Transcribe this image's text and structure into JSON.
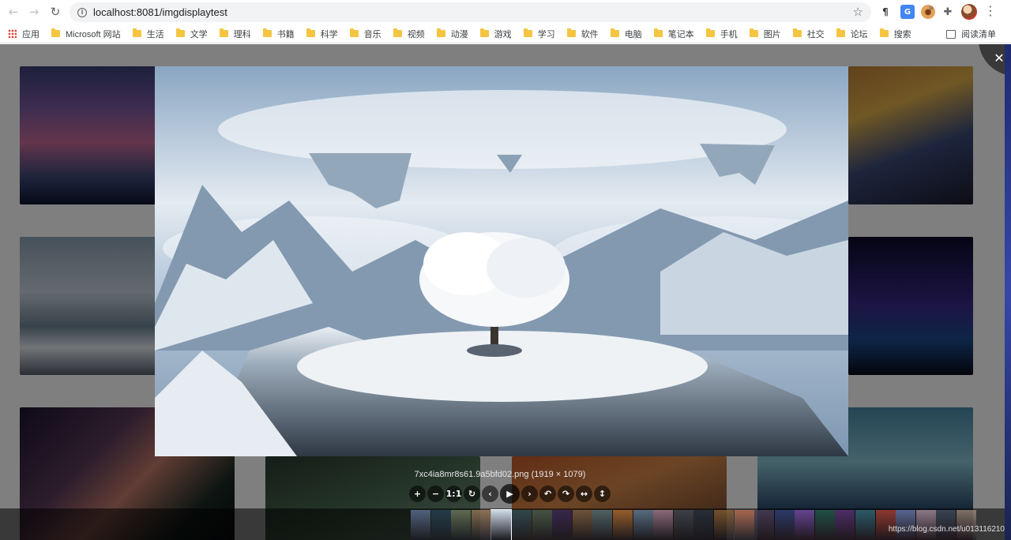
{
  "browser": {
    "url": "localhost:8081/imgdisplaytest",
    "bookmarks": [
      {
        "label": "应用",
        "type": "apps"
      },
      {
        "label": "Microsoft 网站",
        "type": "folder"
      },
      {
        "label": "生活",
        "type": "folder"
      },
      {
        "label": "文学",
        "type": "folder"
      },
      {
        "label": "理科",
        "type": "folder"
      },
      {
        "label": "书籍",
        "type": "folder"
      },
      {
        "label": "科学",
        "type": "folder"
      },
      {
        "label": "音乐",
        "type": "folder"
      },
      {
        "label": "视频",
        "type": "folder"
      },
      {
        "label": "动漫",
        "type": "folder"
      },
      {
        "label": "游戏",
        "type": "folder"
      },
      {
        "label": "学习",
        "type": "folder"
      },
      {
        "label": "软件",
        "type": "folder"
      },
      {
        "label": "电脑",
        "type": "folder"
      },
      {
        "label": "笔记本",
        "type": "folder"
      },
      {
        "label": "手机",
        "type": "folder"
      },
      {
        "label": "图片",
        "type": "folder"
      },
      {
        "label": "社交",
        "type": "folder"
      },
      {
        "label": "论坛",
        "type": "folder"
      },
      {
        "label": "搜索",
        "type": "folder"
      }
    ],
    "more_label": "»",
    "reading_list": "阅读清单"
  },
  "viewer": {
    "title": "7xc4ia8mr8s61.9a5bfd02.png (1919 × 1079)",
    "close_icon": "close-icon",
    "toolbar": [
      {
        "name": "zoom-in-button",
        "glyph": "+"
      },
      {
        "name": "zoom-out-button",
        "glyph": "−"
      },
      {
        "name": "one-to-one-button",
        "glyph": "1:1"
      },
      {
        "name": "reset-button",
        "glyph": "↻"
      },
      {
        "name": "prev-button",
        "glyph": "‹"
      },
      {
        "name": "play-button",
        "glyph": "▶"
      },
      {
        "name": "next-button",
        "glyph": "›"
      },
      {
        "name": "rotate-left-button",
        "glyph": "↶"
      },
      {
        "name": "rotate-right-button",
        "glyph": "↷"
      },
      {
        "name": "flip-horizontal-button",
        "glyph": "↔"
      },
      {
        "name": "flip-vertical-button",
        "glyph": "↕"
      }
    ],
    "thumbnail_colors": [
      "#6b7fa8",
      "#2b4a5e",
      "#7d8b6a",
      "#b08a64",
      "#cfdbe8",
      "#2f5a66",
      "#4d6a5a",
      "#3b2a66",
      "#8a6b4d",
      "#5f7f8a",
      "#c47a3a",
      "#6b8fb0",
      "#b58ea6",
      "#48525e",
      "#2a3a4a",
      "#9a6b3a",
      "#d67b5a",
      "#5a4a6a",
      "#3a4a8a",
      "#8a5ac4",
      "#2a6b5a",
      "#6a3a8a",
      "#3a7a8a",
      "#c44a3a",
      "#7a8ac4",
      "#c4a6b5",
      "#4a5a6a",
      "#b09a8a"
    ],
    "active_thumbnail": 4
  },
  "watermark": "https://blog.csdn.net/u013116210"
}
